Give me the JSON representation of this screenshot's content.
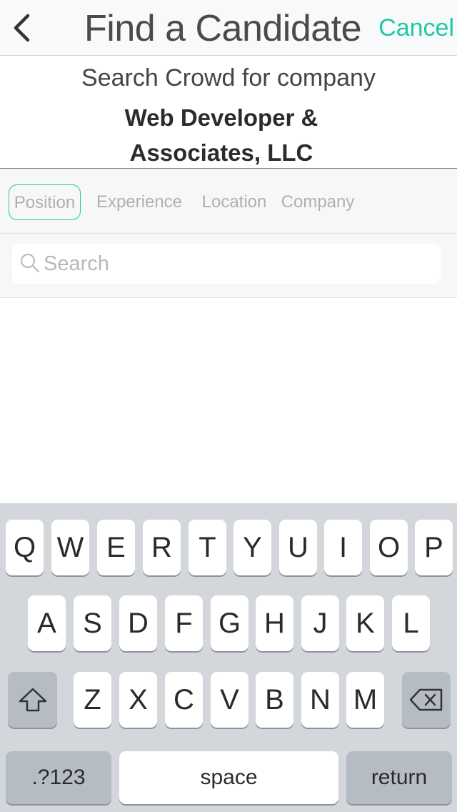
{
  "nav": {
    "title": "Find a Candidate",
    "cancel_label": "Cancel",
    "back_icon": "chevron-left-icon",
    "accent_color": "#1ec9a3"
  },
  "header": {
    "subtitle": "Search Crowd for company",
    "company_line1": "Web Developer &",
    "company_line2": "Associates, LLC"
  },
  "filters": {
    "tabs": [
      {
        "label": "Position",
        "active": true
      },
      {
        "label": "Experience",
        "active": false
      },
      {
        "label": "Location",
        "active": false
      },
      {
        "label": "Company",
        "active": false
      }
    ]
  },
  "search": {
    "placeholder": "Search",
    "value": "",
    "icon": "search-icon"
  },
  "keyboard": {
    "row1": [
      "Q",
      "W",
      "E",
      "R",
      "T",
      "Y",
      "U",
      "I",
      "O",
      "P"
    ],
    "row2": [
      "A",
      "S",
      "D",
      "F",
      "G",
      "H",
      "J",
      "K",
      "L"
    ],
    "row3": [
      "Z",
      "X",
      "C",
      "V",
      "B",
      "N",
      "M"
    ],
    "shift_icon": "shift-icon",
    "delete_icon": "backspace-icon",
    "numbers_label": ".?123",
    "space_label": "space",
    "return_label": "return"
  }
}
